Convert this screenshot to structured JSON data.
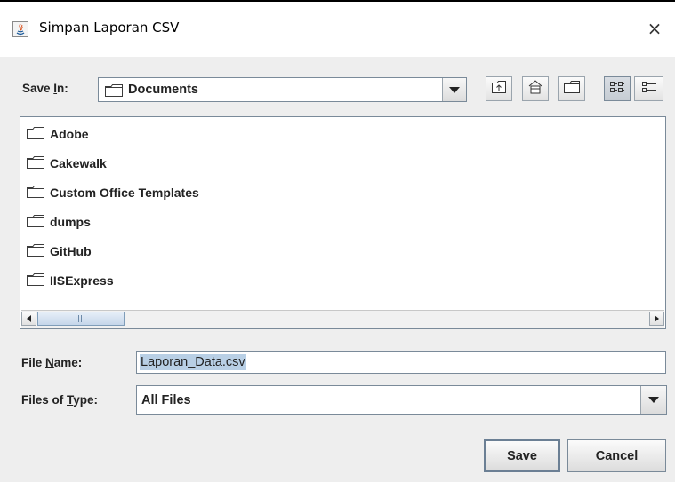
{
  "window": {
    "title": "Simpan Laporan CSV",
    "close_glyph": "×"
  },
  "toolbar": {
    "save_in_label_pre": "Save ",
    "save_in_label_mnemonic": "I",
    "save_in_label_post": "n:",
    "location_value": "Documents",
    "buttons": [
      "up-one-level-icon",
      "home-icon",
      "new-folder-icon",
      "list-view-icon",
      "details-view-icon"
    ]
  },
  "files": {
    "items": [
      {
        "name": "Adobe",
        "icon": "folder-icon"
      },
      {
        "name": "Cakewalk",
        "icon": "folder-icon"
      },
      {
        "name": "Custom Office Templates",
        "icon": "folder-icon"
      },
      {
        "name": "dumps",
        "icon": "folder-icon"
      },
      {
        "name": "GitHub",
        "icon": "folder-icon"
      },
      {
        "name": "IISExpress",
        "icon": "folder-icon"
      }
    ]
  },
  "form": {
    "file_name_pre": "File ",
    "file_name_mnemonic": "N",
    "file_name_post": "ame:",
    "file_name_value": "Laporan_Data.csv",
    "file_type_pre": "Files of ",
    "file_type_mnemonic": "T",
    "file_type_post": "ype:",
    "file_type_value": "All Files"
  },
  "actions": {
    "save_label": "Save",
    "cancel_label": "Cancel"
  },
  "colors": {
    "selection": "#b8cfe5",
    "border": "#7a8a99",
    "background": "#eeeeee"
  }
}
